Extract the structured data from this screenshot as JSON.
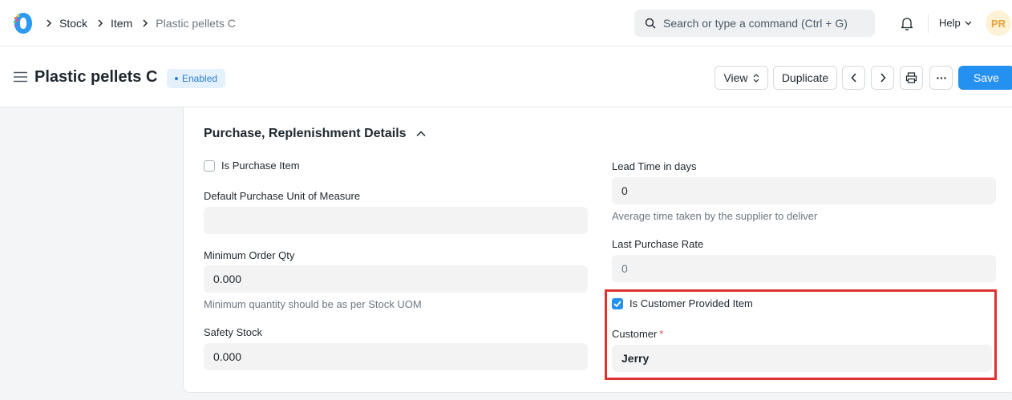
{
  "breadcrumbs": [
    "Stock",
    "Item",
    "Plastic pellets C"
  ],
  "search": {
    "placeholder": "Search or type a command (Ctrl + G)"
  },
  "navbar": {
    "help_label": "Help",
    "avatar_initials": "PR"
  },
  "page": {
    "title": "Plastic pellets C",
    "status_badge": "Enabled",
    "buttons": {
      "view": "View",
      "duplicate": "Duplicate",
      "save": "Save"
    }
  },
  "section": {
    "title": "Purchase, Replenishment Details",
    "left": {
      "is_purchase_item": {
        "label": "Is Purchase Item",
        "checked": false
      },
      "default_purchase_uom": {
        "label": "Default Purchase Unit of Measure",
        "value": ""
      },
      "min_order_qty": {
        "label": "Minimum Order Qty",
        "value": "0.000",
        "hint": "Minimum quantity should be as per Stock UOM"
      },
      "safety_stock": {
        "label": "Safety Stock",
        "value": "0.000"
      }
    },
    "right": {
      "lead_time": {
        "label": "Lead Time in days",
        "value": "0",
        "hint": "Average time taken by the supplier to deliver"
      },
      "last_purchase_rate": {
        "label": "Last Purchase Rate",
        "value": "0"
      },
      "is_customer_provided": {
        "label": "Is Customer Provided Item",
        "checked": true
      },
      "customer": {
        "label": "Customer",
        "required_mark": "*",
        "value": "Jerry"
      }
    }
  },
  "colors": {
    "primary": "#2490ef",
    "highlight": "#e03131",
    "badge_bg": "#e4f1fc"
  }
}
